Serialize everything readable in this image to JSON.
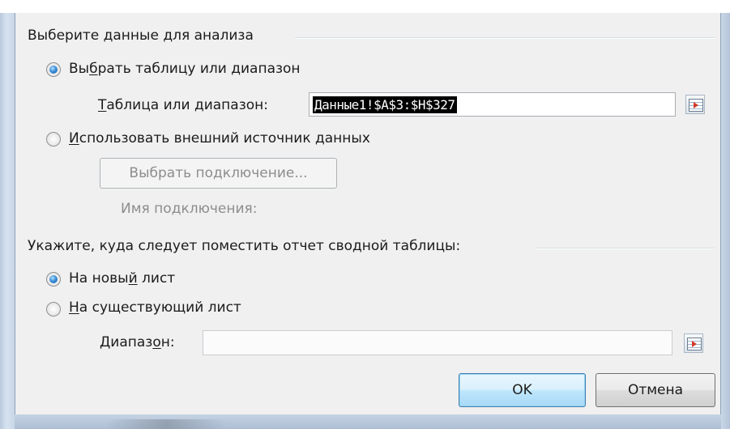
{
  "group_choose_data": {
    "title": "Выберите данные для анализа",
    "radio_table": {
      "label_pre": "Вы",
      "label_key": "б",
      "label_post": "рать таблицу или диапазон",
      "checked": true
    },
    "range_label": {
      "key": "Т",
      "rest": "аблица или диапазон:"
    },
    "range_value": "Данные1!$A$3:$H$327",
    "radio_external": {
      "label_key": "И",
      "label_post": "спользовать внешний источник данных",
      "checked": false
    },
    "choose_connection_button": "Выбрать подключение...",
    "connection_name_label": "Имя подключения:"
  },
  "group_destination": {
    "title": "Укажите, куда следует поместить отчет сводной таблицы:",
    "radio_new_sheet": {
      "label_pre": "На новы",
      "label_key": "й",
      "label_post": " лист",
      "checked": true
    },
    "radio_existing_sheet": {
      "label_key": "Н",
      "label_post": "а существующий лист",
      "checked": false
    },
    "range_label": {
      "pre": "Диапаз",
      "key": "о",
      "post": "н:"
    },
    "range_value": ""
  },
  "buttons": {
    "ok": "OK",
    "cancel": "Отмена"
  },
  "colors": {
    "accent": "#3c7fb1",
    "selection": "#000000",
    "disabled_text": "#8d8d8d"
  }
}
